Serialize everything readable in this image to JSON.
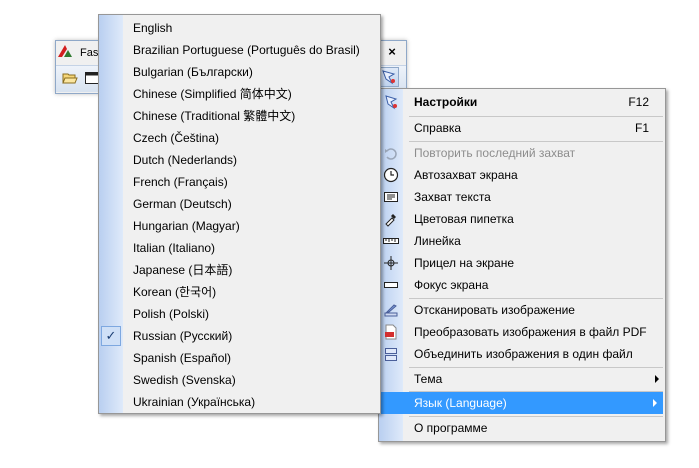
{
  "app_window": {
    "title": "Fast",
    "close_label": "×"
  },
  "language_menu": {
    "items": [
      {
        "label": "English"
      },
      {
        "label": "Brazilian Portuguese (Português do Brasil)"
      },
      {
        "label": "Bulgarian (Български)"
      },
      {
        "label": "Chinese (Simplified 简体中文)"
      },
      {
        "label": "Chinese (Traditional 繁體中文)"
      },
      {
        "label": "Czech (Čeština)"
      },
      {
        "label": "Dutch (Nederlands)"
      },
      {
        "label": "French (Français)"
      },
      {
        "label": "German (Deutsch)"
      },
      {
        "label": "Hungarian (Magyar)"
      },
      {
        "label": "Italian (Italiano)"
      },
      {
        "label": "Japanese (日本語)"
      },
      {
        "label": "Korean (한국어)"
      },
      {
        "label": "Polish (Polski)"
      },
      {
        "label": "Russian (Русский)",
        "checked": true
      },
      {
        "label": "Spanish (Español)"
      },
      {
        "label": "Swedish (Svenska)"
      },
      {
        "label": "Ukrainian (Українська)"
      }
    ],
    "check_mark": "✓"
  },
  "main_menu": {
    "settings": {
      "label": "Настройки",
      "shortcut": "F12"
    },
    "help": {
      "label": "Справка",
      "shortcut": "F1"
    },
    "repeat_capture": {
      "label": "Повторить последний захват"
    },
    "auto_capture": {
      "label": "Автозахват экрана"
    },
    "text_capture": {
      "label": "Захват текста"
    },
    "color_picker": {
      "label": "Цветовая пипетка"
    },
    "ruler": {
      "label": "Линейка"
    },
    "crosshair": {
      "label": "Прицел на экране"
    },
    "focus": {
      "label": "Фокус экрана"
    },
    "scan": {
      "label": "Отсканировать изображение"
    },
    "to_pdf": {
      "label": "Преобразовать изображения в файл PDF"
    },
    "combine": {
      "label": "Объединить изображения в один файл"
    },
    "theme": {
      "label": "Тема"
    },
    "language": {
      "label": "Язык (Language)"
    },
    "about": {
      "label": "О программе"
    }
  },
  "colors": {
    "highlight": "#3399ff",
    "gutter": "#b9cff0",
    "disabled_text": "#8d8d8d"
  }
}
